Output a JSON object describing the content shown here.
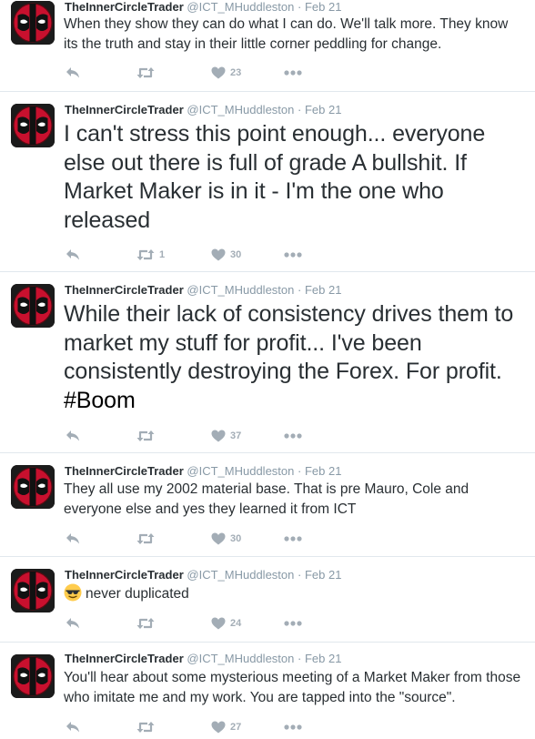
{
  "tweets": [
    {
      "name": "TheInnerCircleTrader",
      "handle": "@ICT_MHuddleston",
      "dot": "·",
      "time": "Feb 21",
      "size": "normal",
      "text": "When they show they can do what I can do. We'll talk more. They know its the truth and stay in their little corner peddling for change.",
      "retweets": "",
      "likes": "23"
    },
    {
      "name": "TheInnerCircleTrader",
      "handle": "@ICT_MHuddleston",
      "dot": "·",
      "time": "Feb 21",
      "size": "large",
      "text": "I can't stress this point enough... everyone else out there is full of grade A bullshit. If Market Maker is in it - I'm the one who released",
      "retweets": "1",
      "likes": "30"
    },
    {
      "name": "TheInnerCircleTrader",
      "handle": "@ICT_MHuddleston",
      "dot": "·",
      "time": "Feb 21",
      "size": "large",
      "text": "While their lack of consistency drives them to market my stuff for profit... I've been consistently destroying the Forex. For profit.",
      "hashtag": "#Boom",
      "retweets": "",
      "likes": "37"
    },
    {
      "name": "TheInnerCircleTrader",
      "handle": "@ICT_MHuddleston",
      "dot": "·",
      "time": "Feb 21",
      "size": "normal",
      "text": "They all use my 2002 material base. That is pre Mauro, Cole and everyone else and yes they learned it from ICT",
      "retweets": "",
      "likes": "30"
    },
    {
      "name": "TheInnerCircleTrader",
      "handle": "@ICT_MHuddleston",
      "dot": "·",
      "time": "Feb 21",
      "size": "normal",
      "emoji": "sunglasses-emoji",
      "text": "never duplicated",
      "retweets": "",
      "likes": "24"
    },
    {
      "name": "TheInnerCircleTrader",
      "handle": "@ICT_MHuddleston",
      "dot": "·",
      "time": "Feb 21",
      "size": "normal",
      "text": "You'll hear about some mysterious meeting of a Market Maker from those who imitate me and my work. You are tapped into the \"source\".",
      "retweets": "",
      "likes": "27"
    }
  ],
  "icons": {
    "avatar": "deadpool-mask-icon",
    "reply": "reply-icon",
    "retweet": "retweet-icon",
    "like": "heart-icon",
    "more": "more-dots-icon"
  },
  "colors": {
    "text": "#292f33",
    "meta": "#8899a6",
    "action": "#a3adb6",
    "divider": "#e1e8ed",
    "avatar_red": "#c8102e"
  }
}
